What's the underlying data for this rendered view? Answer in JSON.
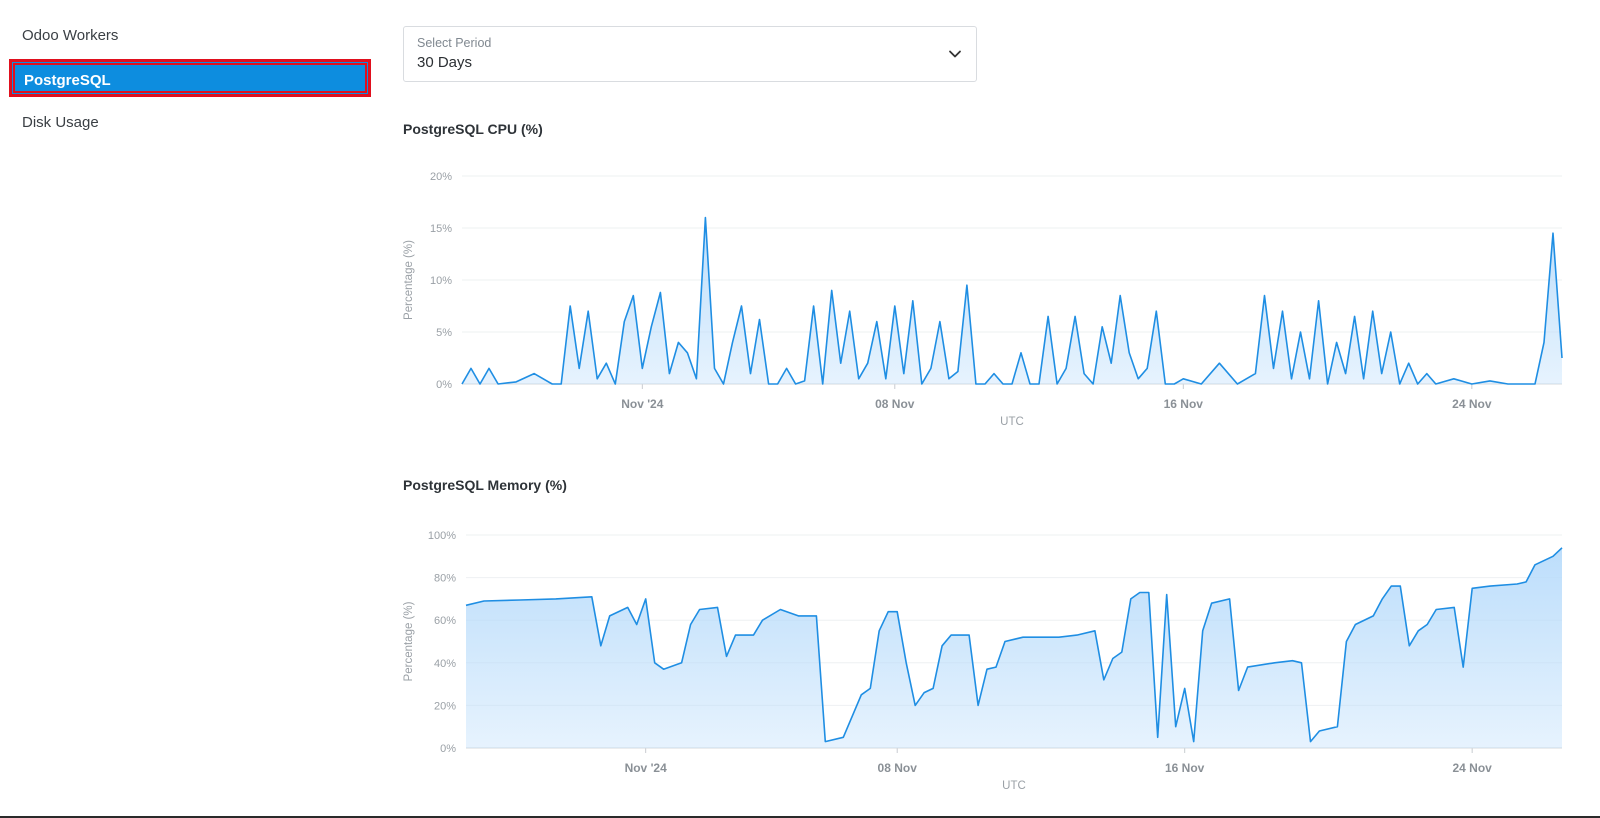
{
  "sidebar": {
    "items": [
      {
        "label": "Odoo Workers",
        "active": false
      },
      {
        "label": "PostgreSQL",
        "active": true
      },
      {
        "label": "Disk Usage",
        "active": false
      }
    ]
  },
  "period_select": {
    "label": "Select Period",
    "value": "30 Days",
    "icon": "chevron-down-icon"
  },
  "colors": {
    "accent": "#0d8ddf",
    "highlight_border": "#e0101e",
    "line": "#1f8ee3",
    "fill": "#b9dcfb"
  },
  "chart_data": [
    {
      "type": "area",
      "title": "PostgreSQL CPU (%)",
      "ylabel": "Percentage (%)",
      "xlabel": "UTC",
      "ylim": [
        0,
        20
      ],
      "yticks": [
        "0%",
        "5%",
        "10%",
        "15%",
        "20%"
      ],
      "xlim": [
        "2024-10-27",
        "2024-11-26T12:00"
      ],
      "xticks": [
        {
          "label": "Nov '24",
          "date": "2024-11-01"
        },
        {
          "label": "08 Nov",
          "date": "2024-11-08"
        },
        {
          "label": "16 Nov",
          "date": "2024-11-16"
        },
        {
          "label": "24 Nov",
          "date": "2024-11-24"
        }
      ],
      "grid": true,
      "series": [
        {
          "points": [
            [
              "2024-10-27T00:00",
              0
            ],
            [
              "2024-10-27T06:00",
              1.5
            ],
            [
              "2024-10-27T12:00",
              0
            ],
            [
              "2024-10-27T18:00",
              1.5
            ],
            [
              "2024-10-28T00:00",
              0
            ],
            [
              "2024-10-28T12:00",
              0.2
            ],
            [
              "2024-10-29T00:00",
              1
            ],
            [
              "2024-10-29T12:00",
              0
            ],
            [
              "2024-10-29T18:00",
              0
            ],
            [
              "2024-10-30T00:00",
              7.5
            ],
            [
              "2024-10-30T06:00",
              1.5
            ],
            [
              "2024-10-30T12:00",
              7
            ],
            [
              "2024-10-30T18:00",
              0.5
            ],
            [
              "2024-10-31T00:00",
              2
            ],
            [
              "2024-10-31T06:00",
              0
            ],
            [
              "2024-10-31T12:00",
              6
            ],
            [
              "2024-10-31T18:00",
              8.5
            ],
            [
              "2024-11-01T00:00",
              1.5
            ],
            [
              "2024-11-01T06:00",
              5.5
            ],
            [
              "2024-11-01T12:00",
              8.8
            ],
            [
              "2024-11-01T18:00",
              1
            ],
            [
              "2024-11-02T00:00",
              4
            ],
            [
              "2024-11-02T06:00",
              3
            ],
            [
              "2024-11-02T12:00",
              0.5
            ],
            [
              "2024-11-02T18:00",
              16
            ],
            [
              "2024-11-03T00:00",
              1.5
            ],
            [
              "2024-11-03T06:00",
              0
            ],
            [
              "2024-11-03T12:00",
              4
            ],
            [
              "2024-11-03T18:00",
              7.5
            ],
            [
              "2024-11-04T00:00",
              1
            ],
            [
              "2024-11-04T06:00",
              6.2
            ],
            [
              "2024-11-04T12:00",
              0
            ],
            [
              "2024-11-04T18:00",
              0
            ],
            [
              "2024-11-05T00:00",
              1.5
            ],
            [
              "2024-11-05T06:00",
              0
            ],
            [
              "2024-11-05T12:00",
              0.3
            ],
            [
              "2024-11-05T18:00",
              7.5
            ],
            [
              "2024-11-06T00:00",
              0
            ],
            [
              "2024-11-06T06:00",
              9
            ],
            [
              "2024-11-06T12:00",
              2
            ],
            [
              "2024-11-06T18:00",
              7
            ],
            [
              "2024-11-07T00:00",
              0.5
            ],
            [
              "2024-11-07T06:00",
              2
            ],
            [
              "2024-11-07T12:00",
              6
            ],
            [
              "2024-11-07T18:00",
              0.5
            ],
            [
              "2024-11-08T00:00",
              7.5
            ],
            [
              "2024-11-08T06:00",
              1
            ],
            [
              "2024-11-08T12:00",
              8
            ],
            [
              "2024-11-08T18:00",
              0
            ],
            [
              "2024-11-09T00:00",
              1.5
            ],
            [
              "2024-11-09T06:00",
              6
            ],
            [
              "2024-11-09T12:00",
              0.5
            ],
            [
              "2024-11-09T18:00",
              1.2
            ],
            [
              "2024-11-10T00:00",
              9.5
            ],
            [
              "2024-11-10T06:00",
              0
            ],
            [
              "2024-11-10T12:00",
              0
            ],
            [
              "2024-11-10T18:00",
              1
            ],
            [
              "2024-11-11T00:00",
              0
            ],
            [
              "2024-11-11T06:00",
              0
            ],
            [
              "2024-11-11T12:00",
              3
            ],
            [
              "2024-11-11T18:00",
              0
            ],
            [
              "2024-11-12T00:00",
              0
            ],
            [
              "2024-11-12T06:00",
              6.5
            ],
            [
              "2024-11-12T12:00",
              0
            ],
            [
              "2024-11-12T18:00",
              1.5
            ],
            [
              "2024-11-13T00:00",
              6.5
            ],
            [
              "2024-11-13T06:00",
              1
            ],
            [
              "2024-11-13T12:00",
              0
            ],
            [
              "2024-11-13T18:00",
              5.5
            ],
            [
              "2024-11-14T00:00",
              2
            ],
            [
              "2024-11-14T06:00",
              8.5
            ],
            [
              "2024-11-14T12:00",
              3
            ],
            [
              "2024-11-14T18:00",
              0.5
            ],
            [
              "2024-11-15T00:00",
              1.5
            ],
            [
              "2024-11-15T06:00",
              7
            ],
            [
              "2024-11-15T12:00",
              0
            ],
            [
              "2024-11-15T18:00",
              0
            ],
            [
              "2024-11-16T00:00",
              0.5
            ],
            [
              "2024-11-16T12:00",
              0
            ],
            [
              "2024-11-17T00:00",
              2
            ],
            [
              "2024-11-17T12:00",
              0
            ],
            [
              "2024-11-18T00:00",
              1
            ],
            [
              "2024-11-18T06:00",
              8.5
            ],
            [
              "2024-11-18T12:00",
              1.5
            ],
            [
              "2024-11-18T18:00",
              7
            ],
            [
              "2024-11-19T00:00",
              0.5
            ],
            [
              "2024-11-19T06:00",
              5
            ],
            [
              "2024-11-19T12:00",
              0.5
            ],
            [
              "2024-11-19T18:00",
              8
            ],
            [
              "2024-11-20T00:00",
              0
            ],
            [
              "2024-11-20T06:00",
              4
            ],
            [
              "2024-11-20T12:00",
              1
            ],
            [
              "2024-11-20T18:00",
              6.5
            ],
            [
              "2024-11-21T00:00",
              0.5
            ],
            [
              "2024-11-21T06:00",
              7
            ],
            [
              "2024-11-21T12:00",
              1
            ],
            [
              "2024-11-21T18:00",
              5
            ],
            [
              "2024-11-22T00:00",
              0
            ],
            [
              "2024-11-22T06:00",
              2
            ],
            [
              "2024-11-22T12:00",
              0
            ],
            [
              "2024-11-22T18:00",
              1
            ],
            [
              "2024-11-23T00:00",
              0
            ],
            [
              "2024-11-23T12:00",
              0.5
            ],
            [
              "2024-11-24T00:00",
              0
            ],
            [
              "2024-11-24T12:00",
              0.3
            ],
            [
              "2024-11-25T00:00",
              0
            ],
            [
              "2024-11-25T18:00",
              0
            ],
            [
              "2024-11-26T00:00",
              4
            ],
            [
              "2024-11-26T06:00",
              14.5
            ],
            [
              "2024-11-26T12:00",
              2.5
            ]
          ]
        }
      ]
    },
    {
      "type": "area",
      "title": "PostgreSQL Memory (%)",
      "ylabel": "Percentage (%)",
      "xlabel": "UTC",
      "ylim": [
        0,
        100
      ],
      "yticks": [
        "0%",
        "20%",
        "40%",
        "60%",
        "80%",
        "100%"
      ],
      "xlim": [
        "2024-10-27",
        "2024-11-26T12:00"
      ],
      "xticks": [
        {
          "label": "Nov '24",
          "date": "2024-11-01"
        },
        {
          "label": "08 Nov",
          "date": "2024-11-08"
        },
        {
          "label": "16 Nov",
          "date": "2024-11-16"
        },
        {
          "label": "24 Nov",
          "date": "2024-11-24"
        }
      ],
      "grid": true,
      "series": [
        {
          "points": [
            [
              "2024-10-27T00:00",
              67
            ],
            [
              "2024-10-27T12:00",
              69
            ],
            [
              "2024-10-28T12:00",
              69.5
            ],
            [
              "2024-10-29T12:00",
              70
            ],
            [
              "2024-10-30T12:00",
              71
            ],
            [
              "2024-10-30T18:00",
              48
            ],
            [
              "2024-10-31T00:00",
              62
            ],
            [
              "2024-10-31T12:00",
              66
            ],
            [
              "2024-10-31T18:00",
              58
            ],
            [
              "2024-11-01T00:00",
              70
            ],
            [
              "2024-11-01T06:00",
              40
            ],
            [
              "2024-11-01T12:00",
              37
            ],
            [
              "2024-11-02T00:00",
              40
            ],
            [
              "2024-11-02T06:00",
              58
            ],
            [
              "2024-11-02T12:00",
              65
            ],
            [
              "2024-11-03T00:00",
              66
            ],
            [
              "2024-11-03T06:00",
              43
            ],
            [
              "2024-11-03T12:00",
              53
            ],
            [
              "2024-11-04T00:00",
              53
            ],
            [
              "2024-11-04T06:00",
              60
            ],
            [
              "2024-11-04T18:00",
              65
            ],
            [
              "2024-11-05T06:00",
              62
            ],
            [
              "2024-11-05T18:00",
              62
            ],
            [
              "2024-11-06T00:00",
              3
            ],
            [
              "2024-11-06T12:00",
              5
            ],
            [
              "2024-11-06T18:00",
              15
            ],
            [
              "2024-11-07T00:00",
              25
            ],
            [
              "2024-11-07T06:00",
              28
            ],
            [
              "2024-11-07T12:00",
              55
            ],
            [
              "2024-11-07T18:00",
              64
            ],
            [
              "2024-11-08T00:00",
              64
            ],
            [
              "2024-11-08T06:00",
              40
            ],
            [
              "2024-11-08T12:00",
              20
            ],
            [
              "2024-11-08T18:00",
              26
            ],
            [
              "2024-11-09T00:00",
              28
            ],
            [
              "2024-11-09T06:00",
              48
            ],
            [
              "2024-11-09T12:00",
              53
            ],
            [
              "2024-11-10T00:00",
              53
            ],
            [
              "2024-11-10T06:00",
              20
            ],
            [
              "2024-11-10T12:00",
              37
            ],
            [
              "2024-11-10T18:00",
              38
            ],
            [
              "2024-11-11T00:00",
              50
            ],
            [
              "2024-11-11T12:00",
              52
            ],
            [
              "2024-11-12T12:00",
              52
            ],
            [
              "2024-11-13T00:00",
              53
            ],
            [
              "2024-11-13T12:00",
              55
            ],
            [
              "2024-11-13T18:00",
              32
            ],
            [
              "2024-11-14T00:00",
              42
            ],
            [
              "2024-11-14T06:00",
              45
            ],
            [
              "2024-11-14T12:00",
              70
            ],
            [
              "2024-11-14T18:00",
              73
            ],
            [
              "2024-11-15T00:00",
              73
            ],
            [
              "2024-11-15T06:00",
              5
            ],
            [
              "2024-11-15T12:00",
              72
            ],
            [
              "2024-11-15T18:00",
              10
            ],
            [
              "2024-11-16T00:00",
              28
            ],
            [
              "2024-11-16T06:00",
              3
            ],
            [
              "2024-11-16T12:00",
              55
            ],
            [
              "2024-11-16T18:00",
              68
            ],
            [
              "2024-11-17T06:00",
              70
            ],
            [
              "2024-11-17T12:00",
              27
            ],
            [
              "2024-11-17T18:00",
              38
            ],
            [
              "2024-11-18T12:00",
              40
            ],
            [
              "2024-11-19T00:00",
              41
            ],
            [
              "2024-11-19T06:00",
              40
            ],
            [
              "2024-11-19T12:00",
              3
            ],
            [
              "2024-11-19T18:00",
              8
            ],
            [
              "2024-11-20T06:00",
              10
            ],
            [
              "2024-11-20T12:00",
              50
            ],
            [
              "2024-11-20T18:00",
              58
            ],
            [
              "2024-11-21T06:00",
              62
            ],
            [
              "2024-11-21T12:00",
              70
            ],
            [
              "2024-11-21T18:00",
              76
            ],
            [
              "2024-11-22T00:00",
              76
            ],
            [
              "2024-11-22T06:00",
              48
            ],
            [
              "2024-11-22T12:00",
              55
            ],
            [
              "2024-11-22T18:00",
              58
            ],
            [
              "2024-11-23T00:00",
              65
            ],
            [
              "2024-11-23T12:00",
              66
            ],
            [
              "2024-11-23T18:00",
              38
            ],
            [
              "2024-11-24T00:00",
              75
            ],
            [
              "2024-11-24T12:00",
              76
            ],
            [
              "2024-11-25T06:00",
              77
            ],
            [
              "2024-11-25T12:00",
              78
            ],
            [
              "2024-11-25T18:00",
              86
            ],
            [
              "2024-11-26T06:00",
              90
            ],
            [
              "2024-11-26T12:00",
              94
            ]
          ]
        }
      ]
    }
  ]
}
